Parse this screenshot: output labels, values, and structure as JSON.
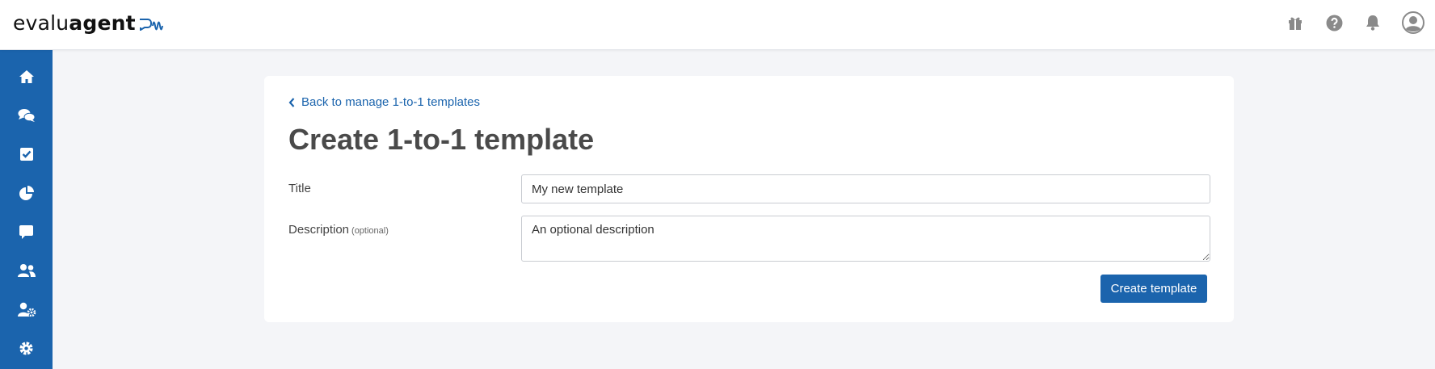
{
  "brand": {
    "logo_light": "evalu",
    "logo_bold": "agent",
    "sidebar_color": "#1b64ad",
    "accent_color": "#1b64ad"
  },
  "topbar": {
    "icons": [
      "gift-icon",
      "help-icon",
      "bell-icon",
      "user-avatar-icon"
    ]
  },
  "sidebar": {
    "items": [
      {
        "icon": "home-icon"
      },
      {
        "icon": "comments-icon"
      },
      {
        "icon": "checkbox-icon"
      },
      {
        "icon": "pie-chart-icon"
      },
      {
        "icon": "chat-icon"
      },
      {
        "icon": "users-icon"
      },
      {
        "icon": "user-settings-icon"
      },
      {
        "icon": "gear-icon"
      }
    ]
  },
  "main": {
    "back_link": "Back to manage 1-to-1 templates",
    "title": "Create 1-to-1 template",
    "form": {
      "title_label": "Title",
      "title_value": "My new template",
      "description_label": "Description",
      "description_optional": "(optional)",
      "description_value": "An optional description"
    },
    "submit_label": "Create template"
  }
}
